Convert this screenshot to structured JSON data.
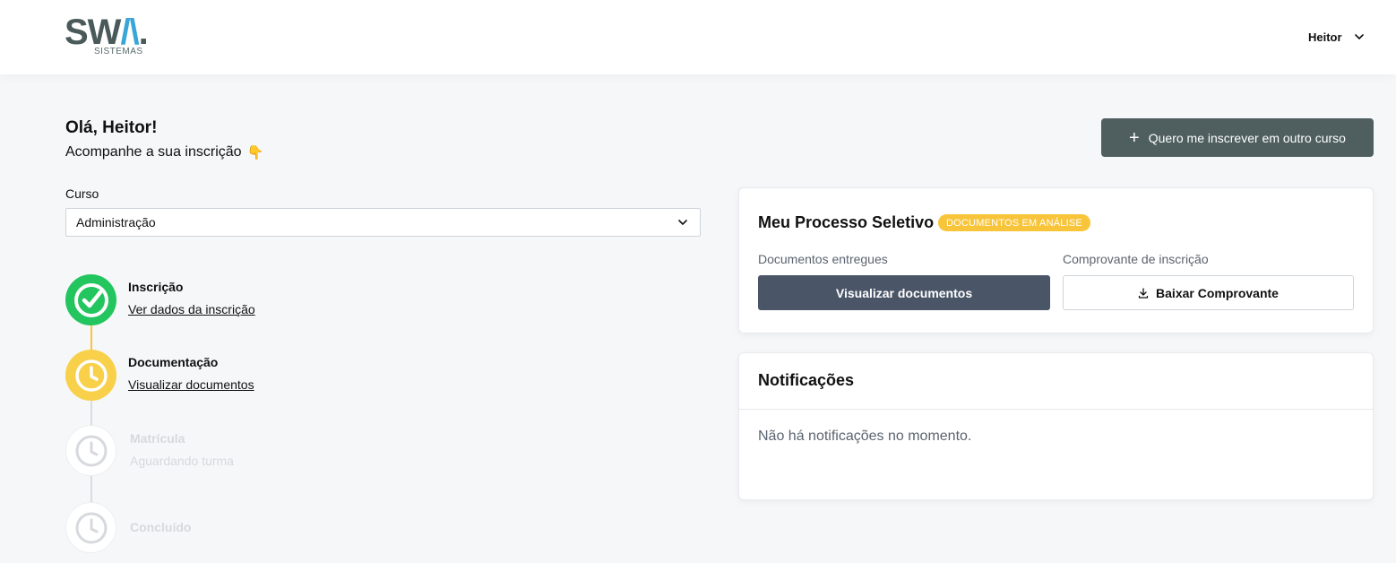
{
  "header": {
    "logo_text_a": "SW",
    "logo_text_b": "/\\",
    "logo_text_c": ".",
    "logo_sub": "SISTEMAS",
    "user_name": "Heitor"
  },
  "main": {
    "greeting": "Olá, Heitor!",
    "subtitle": "Acompanhe a sua inscrição",
    "subtitle_emoji": "👇",
    "new_course_button": "Quero me inscrever em outro curso",
    "course_label": "Curso",
    "course_selected": "Administração"
  },
  "steps": [
    {
      "title": "Inscrição",
      "link": "Ver dados da inscrição",
      "status": "done"
    },
    {
      "title": "Documentação",
      "link": "Visualizar documentos",
      "status": "in-progress"
    },
    {
      "title": "Matrícula",
      "sub": "Aguardando turma",
      "status": "pending"
    },
    {
      "title": "Concluído",
      "status": "pending"
    }
  ],
  "process_card": {
    "title": "Meu Processo Seletivo",
    "badge": "DOCUMENTOS EM ANÁLISE",
    "docs_label": "Documentos entregues",
    "docs_button": "Visualizar documentos",
    "receipt_label": "Comprovante de inscrição",
    "receipt_button": "Baixar Comprovante"
  },
  "notifications": {
    "title": "Notificações",
    "empty_text": "Não há notificações no momento."
  },
  "colors": {
    "done": "#22c55e",
    "in_progress": "#f8c43a",
    "pending": "#e2e5e9",
    "primary_dark": "#4f5f60",
    "button_dark": "#4a5668"
  }
}
